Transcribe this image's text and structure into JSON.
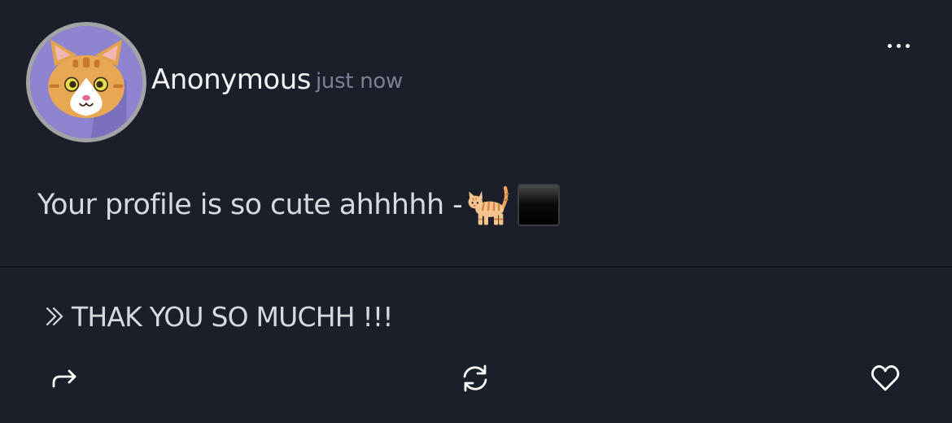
{
  "post": {
    "author": "Anonymous",
    "timestamp": "just now",
    "message_text": "Your profile is so cute ahhhhh -",
    "message_emojis": [
      "cat-emoji",
      "black-square-emoji"
    ]
  },
  "reply": {
    "icon": "double-chevron-right-icon",
    "text": "THAK YOU SO MUCHH !!!"
  },
  "actions": [
    {
      "name": "share",
      "icon": "share-arrow-icon"
    },
    {
      "name": "refresh",
      "icon": "refresh-icon"
    },
    {
      "name": "like",
      "icon": "heart-icon"
    }
  ],
  "menu": {
    "icon": "more-options-icon"
  },
  "colors": {
    "background": "#1b1f2a",
    "avatar_background": "#8d83cf",
    "text": "#d8d9dc",
    "timestamp": "#7b8191"
  }
}
